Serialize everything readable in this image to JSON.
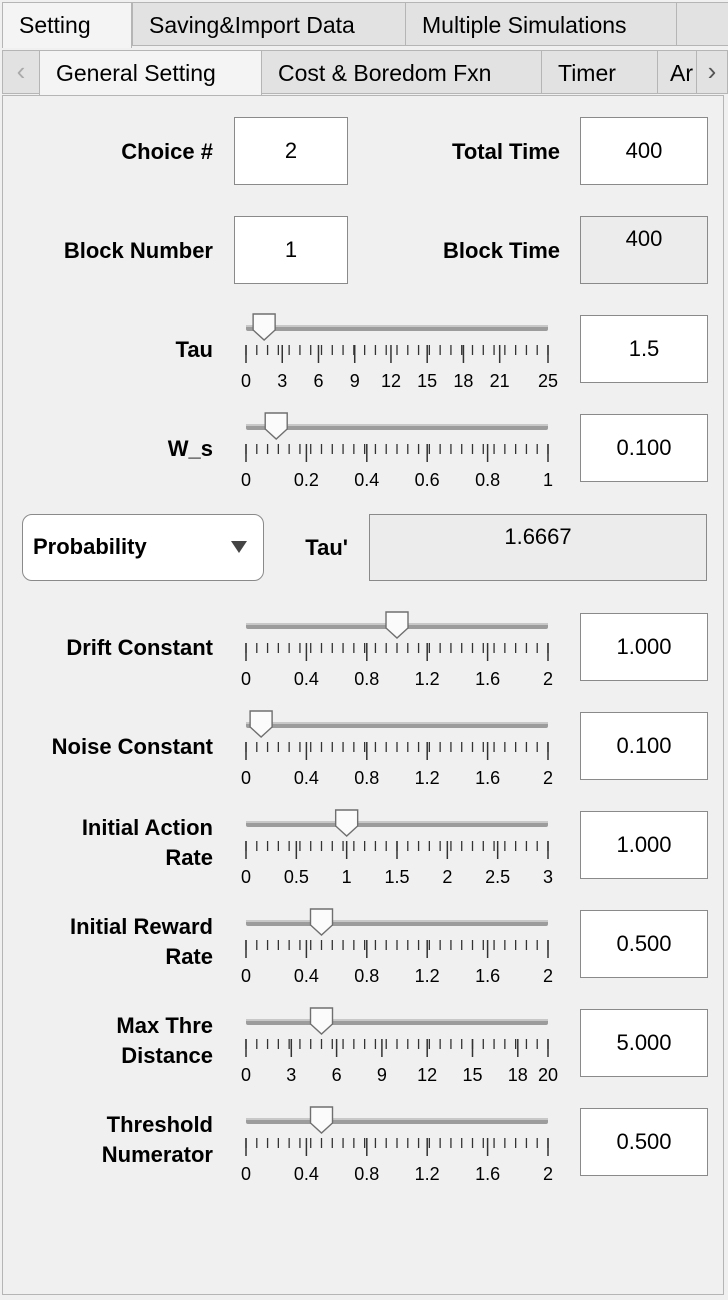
{
  "top_tabs": [
    "Setting",
    "Saving&Import Data",
    "Multiple Simulations"
  ],
  "sub_tabs": [
    "General Setting",
    "Cost & Boredom Fxn",
    "Timer",
    "Ar"
  ],
  "fields": {
    "choice_label": "Choice #",
    "choice_value": "2",
    "total_time_label": "Total Time",
    "total_time_value": "400",
    "block_number_label": "Block Number",
    "block_number_value": "1",
    "block_time_label": "Block Time",
    "block_time_value": "400",
    "tau_prime_label": "Tau'",
    "tau_prime_value": "1.6667",
    "dropdown_value": "Probability"
  },
  "sliders": [
    {
      "id": "tau",
      "label": [
        "Tau"
      ],
      "value_text": "1.5",
      "value": 1.5,
      "min": 0,
      "max": 25,
      "ticks": [
        "0",
        "3",
        "6",
        "9",
        "12",
        "15",
        "18",
        "21",
        "25"
      ]
    },
    {
      "id": "ws",
      "label": [
        "W_s"
      ],
      "value_text": "0.100",
      "value": 0.1,
      "min": 0,
      "max": 1,
      "ticks": [
        "0",
        "0.2",
        "0.4",
        "0.6",
        "0.8",
        "1"
      ]
    },
    {
      "id": "drift",
      "label": [
        "Drift Constant"
      ],
      "value_text": "1.000",
      "value": 1.0,
      "min": 0,
      "max": 2,
      "ticks": [
        "0",
        "0.4",
        "0.8",
        "1.2",
        "1.6",
        "2"
      ]
    },
    {
      "id": "noise",
      "label": [
        "Noise Constant"
      ],
      "value_text": "0.100",
      "value": 0.1,
      "min": 0,
      "max": 2,
      "ticks": [
        "0",
        "0.4",
        "0.8",
        "1.2",
        "1.6",
        "2"
      ]
    },
    {
      "id": "action",
      "label": [
        "Initial Action",
        "Rate"
      ],
      "value_text": "1.000",
      "value": 1.0,
      "min": 0,
      "max": 3,
      "ticks": [
        "0",
        "0.5",
        "1",
        "1.5",
        "2",
        "2.5",
        "3"
      ]
    },
    {
      "id": "reward",
      "label": [
        "Initial Reward",
        "Rate"
      ],
      "value_text": "0.500",
      "value": 0.5,
      "min": 0,
      "max": 2,
      "ticks": [
        "0",
        "0.4",
        "0.8",
        "1.2",
        "1.6",
        "2"
      ]
    },
    {
      "id": "maxthre",
      "label": [
        "Max Thre",
        "Distance"
      ],
      "value_text": "5.000",
      "value": 5.0,
      "min": 0,
      "max": 20,
      "ticks": [
        "0",
        "3",
        "6",
        "9",
        "12",
        "15",
        "18",
        "20"
      ]
    },
    {
      "id": "thresh",
      "label": [
        "Threshold",
        "Numerator"
      ],
      "value_text": "0.500",
      "value": 0.5,
      "min": 0,
      "max": 2,
      "ticks": [
        "0",
        "0.4",
        "0.8",
        "1.2",
        "1.6",
        "2"
      ]
    }
  ]
}
